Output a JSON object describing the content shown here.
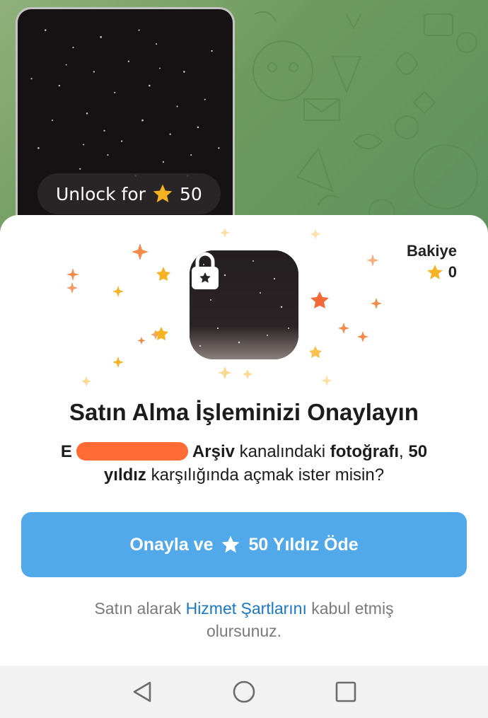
{
  "media": {
    "unlock_text": "Unlock for",
    "unlock_amount": "50",
    "star_icon": "star-icon"
  },
  "sheet": {
    "balance_title": "Bakiye",
    "balance_value": "0",
    "lock_icon": "lock-star-icon",
    "title": "Satın Alma İşleminizi Onaylayın",
    "desc_prefix": "E",
    "desc_redacted_note": "redacted channel name",
    "desc_channel_tail": "Arşiv",
    "desc_part1": "kanalındaki",
    "desc_bold1": "fotoğrafı",
    "desc_part2": ",",
    "desc_bold2": "50 yıldız",
    "desc_part3": "karşılığında açmak ister misin?",
    "pay_button_prefix": "Onayla ve",
    "pay_button_suffix": "50 Yıldız Öde",
    "terms_before": "Satın alarak",
    "terms_link": "Hizmet Şartlarını",
    "terms_after": "kabul etmiş olursunuz."
  },
  "navbar": {
    "back_icon": "back-triangle-icon",
    "home_icon": "home-circle-icon",
    "recents_icon": "recents-square-icon"
  },
  "colors": {
    "accent": "#52a9e9",
    "link": "#1a78c2",
    "star": "#f5b324",
    "redaction": "#ff6b35",
    "chat_background": "#6f9a5f"
  }
}
